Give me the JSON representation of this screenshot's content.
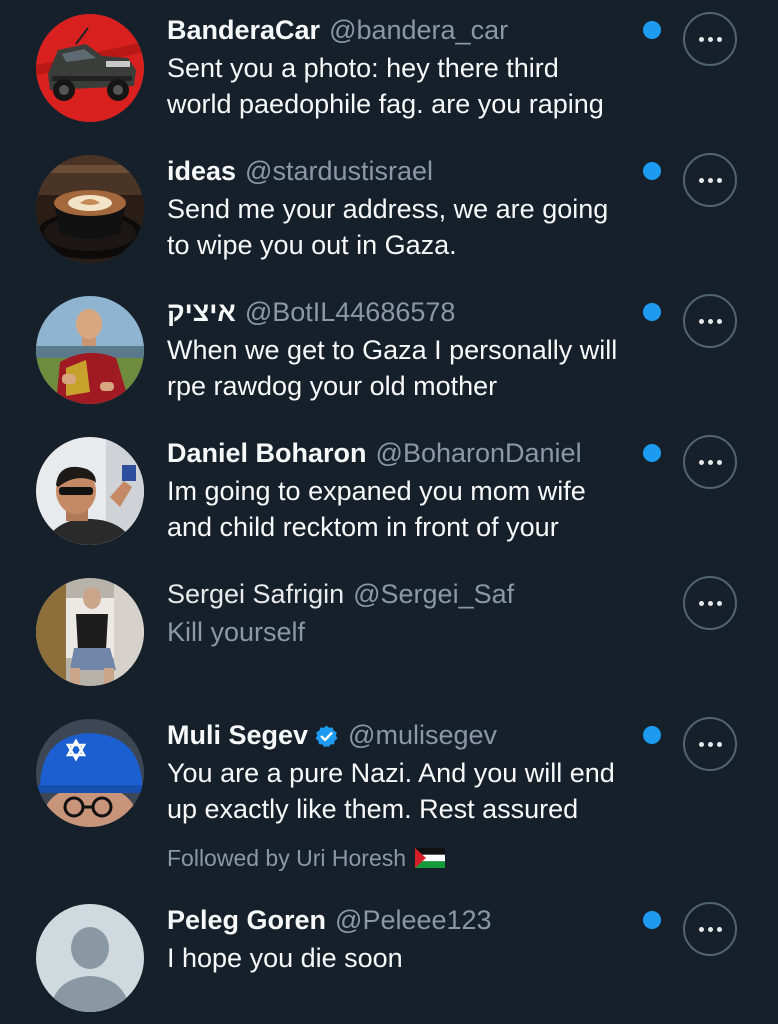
{
  "colors": {
    "background": "#15202b",
    "primary_text": "#f7f9f9",
    "secondary_text": "#8b98a5",
    "unread_dot": "#1d9bf0",
    "verified_badge": "#1d9bf0",
    "button_border": "#536471"
  },
  "more_icon": "more-horizontal-icon",
  "conversations": [
    {
      "display_name": "BanderaCar",
      "handle": "@bandera_car",
      "message": "Sent you a photo: hey there third\nworld paedophile fag. are you raping",
      "unread": true,
      "avatar_icon": "red-pickup-truck-avatar"
    },
    {
      "display_name": "ideas",
      "handle": "@stardustisrael",
      "message": "Send me your address, we are going\nto wipe you out in Gaza.",
      "unread": true,
      "avatar_icon": "latte-cup-avatar"
    },
    {
      "display_name": "איציק",
      "handle": "@BotIL44686578",
      "message": "When we get to Gaza I personally will\nrpe rawdog your old mother",
      "unread": true,
      "avatar_icon": "monk-in-red-robe-avatar"
    },
    {
      "display_name": "Daniel Boharon",
      "handle": "@BoharonDaniel",
      "message": "Im going to expaned you mom wife\nand child recktom in front of your",
      "unread": true,
      "avatar_icon": "man-with-sunglasses-avatar"
    },
    {
      "display_name": "Sergei Safrigin",
      "handle": "@Sergei_Saf",
      "message": "Kill yourself",
      "unread": false,
      "avatar_icon": "seated-man-avatar"
    },
    {
      "display_name": "Muli Segev",
      "handle": "@mulisegev",
      "message": "You are a pure Nazi. And you will end\nup exactly like them. Rest assured",
      "unread": true,
      "verified": true,
      "verified_icon": "verified-badge-icon",
      "followed_by": "Followed by Uri Horesh",
      "followed_by_icon": "palestine-flag-icon",
      "avatar_icon": "man-in-blue-cap-avatar"
    },
    {
      "display_name": "Peleg Goren",
      "handle": "@Peleee123",
      "message": "I hope you die soon",
      "unread": true,
      "avatar_icon": "default-profile-avatar"
    }
  ]
}
